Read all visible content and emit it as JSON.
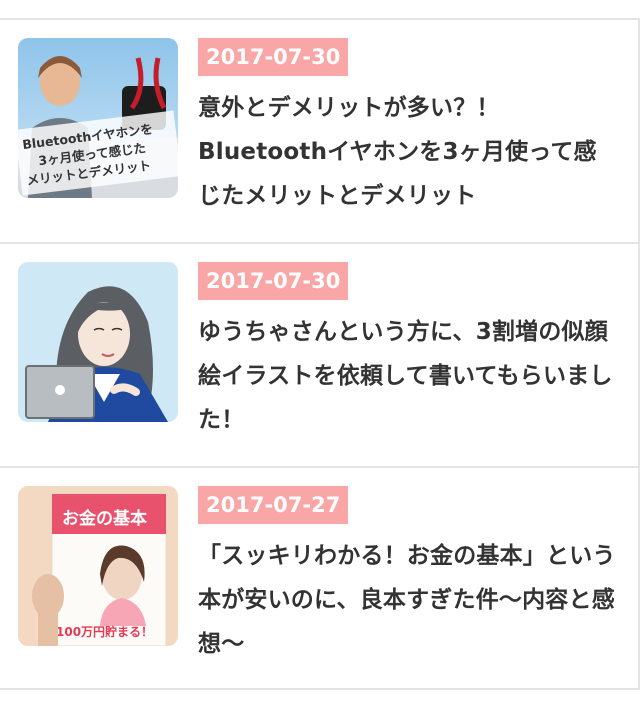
{
  "articles": [
    {
      "date": "2017-07-30",
      "title": "意外とデメリットが多い？！Bluetoothイヤホンを3ヶ月使って感じたメリットとデメリット",
      "thumbnail_text": [
        "Bluetoothイヤホンを",
        "3ヶ月使って感じた",
        "メリットとデメリット"
      ],
      "thumbnail_icon": "earphones-photo-icon"
    },
    {
      "date": "2017-07-30",
      "title": "ゆうちゃさんという方に、3割増の似顔絵イラストを依頼して書いてもらいました！",
      "thumbnail_icon": "portrait-illustration-icon"
    },
    {
      "date": "2017-07-27",
      "title": "「スッキリわかる！お金の基本」という本が安いのに、良本すぎた件〜内容と感想〜",
      "thumbnail_text": [
        "お金の基本",
        "100万円貯まる！"
      ],
      "thumbnail_icon": "book-cover-photo-icon"
    }
  ],
  "colors": {
    "date_badge_bg": "#f9a6a6",
    "title_text": "#333333",
    "divider": "#e3e3e3"
  }
}
